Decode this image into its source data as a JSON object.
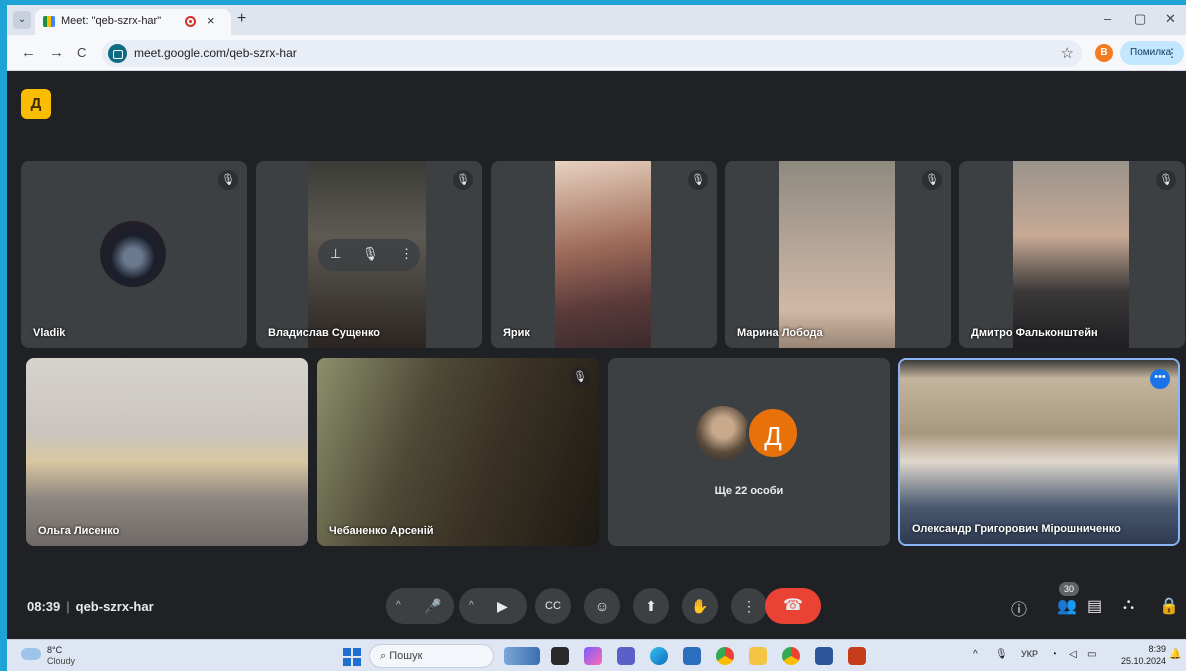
{
  "browser": {
    "tab_title": "Meet: \"qeb-szrx-har\"",
    "tab_close": "×",
    "new_tab": "+",
    "url": "meet.google.com/qeb-szrx-har",
    "profile_letter": "В",
    "error_label": "Помилка",
    "nav": {
      "back": "←",
      "forward": "→",
      "reload": "C"
    },
    "window": {
      "minimize": "–",
      "restore": "▢",
      "close": "✕"
    },
    "dropdown": "⌄",
    "star": "☆",
    "menu": "⋮"
  },
  "meet": {
    "logo_text": "Д",
    "participants_row1": [
      {
        "name": "Vladik",
        "muted": true,
        "kind": "avatar"
      },
      {
        "name": "Владислав Сущенко",
        "muted": true,
        "kind": "video"
      },
      {
        "name": "Ярик",
        "muted": true,
        "kind": "video"
      },
      {
        "name": "Марина Лобода",
        "muted": true,
        "kind": "video"
      },
      {
        "name": "Дмитро Фальконштейн",
        "muted": true,
        "kind": "video"
      }
    ],
    "participants_row2": [
      {
        "name": "Ольга Лисенко",
        "muted": false,
        "kind": "video"
      },
      {
        "name": "Чебаненко Арсеній",
        "muted": true,
        "kind": "video"
      },
      {
        "name": "",
        "kind": "others"
      },
      {
        "name": "Олександр Григорович Мірошниченко",
        "muted": false,
        "kind": "video"
      }
    ],
    "others_label": "Ще 22 особи",
    "others_initial": "Д",
    "hover_controls": {
      "pin": "⊥",
      "mute": "🎙",
      "more": "⋮"
    },
    "more_options": "•••",
    "mute_icon": "🎙",
    "time": "08:39",
    "separator": "|",
    "meeting_code": "qeb-szrx-har",
    "controls": {
      "chevron": "^",
      "mic": "🎤",
      "camera": "▶",
      "captions": "CC",
      "emoji": "☺",
      "present": "⬆",
      "raise_hand": "✋",
      "more": "⋮",
      "end_call": "☎"
    },
    "right_controls": {
      "info": "ⓘ",
      "people": "👥",
      "chat": "▤",
      "activities": "⛬",
      "host": "🔒"
    },
    "people_count": "30"
  },
  "taskbar": {
    "temperature": "8°C",
    "condition": "Cloudy",
    "search_placeholder": "Пошук",
    "language": "УКР",
    "time": "8:39",
    "date": "25.10.2024",
    "tray_arrow": "^"
  }
}
